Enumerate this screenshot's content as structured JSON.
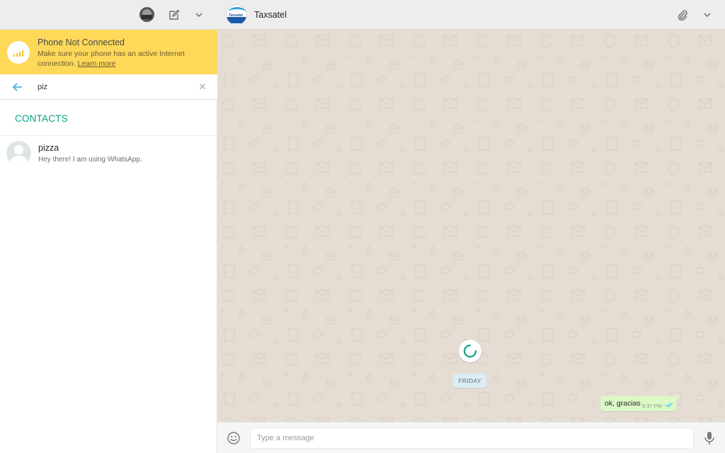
{
  "sidebar": {
    "alert": {
      "title": "Phone Not Connected",
      "text_line1": "Make sure your phone has an active Internet",
      "text_line2_prefix": "connection. ",
      "link": "Learn more"
    },
    "search": {
      "value": "piz"
    },
    "section_title": "CONTACTS",
    "contacts": [
      {
        "name": "pizza",
        "status": "Hey there! I am using WhatsApp."
      }
    ]
  },
  "chat": {
    "name": "Taxsatel",
    "avatar_logo_text": "Taxsatel",
    "date_chip": "FRIDAY",
    "messages": [
      {
        "text": "ok, gracias",
        "time": "6:37 PM",
        "direction": "outgoing",
        "status": "read"
      }
    ],
    "composer": {
      "placeholder": "Type a message"
    }
  },
  "colors": {
    "accent": "#09a185",
    "alert_bg": "#fed859",
    "wallpaper": "#e5ddd4",
    "outgoing_bubble": "#dcf8c6",
    "read_ticks": "#4fc3f7"
  },
  "icons": [
    "avatar",
    "compose-icon",
    "chevron-down-icon",
    "signal-bars-icon",
    "back-arrow-icon",
    "close-icon",
    "attach-icon",
    "loading-spinner-icon",
    "double-check-icon",
    "emoji-icon",
    "mic-icon"
  ]
}
